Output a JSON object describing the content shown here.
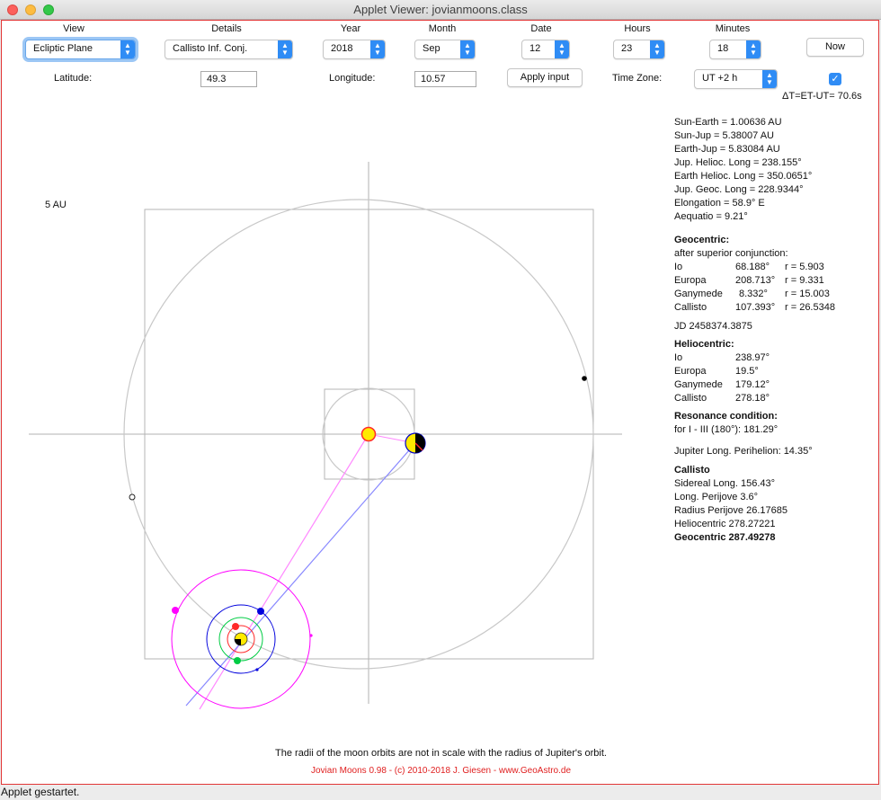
{
  "window": {
    "title": "Applet Viewer: jovianmoons.class"
  },
  "controls": {
    "view": {
      "label": "View",
      "value": "Ecliptic Plane"
    },
    "details": {
      "label": "Details",
      "value": "Callisto Inf. Conj."
    },
    "year": {
      "label": "Year",
      "value": "2018"
    },
    "month": {
      "label": "Month",
      "value": "Sep"
    },
    "date": {
      "label": "Date",
      "value": "12"
    },
    "hours": {
      "label": "Hours",
      "value": "23"
    },
    "minutes": {
      "label": "Minutes",
      "value": "18"
    },
    "now_button": "Now",
    "latitude": {
      "label": "Latitude:",
      "value": "49.3"
    },
    "longitude": {
      "label": "Longitude:",
      "value": "10.57"
    },
    "apply_button": "Apply input",
    "timezone": {
      "label": "Time Zone:",
      "value": "UT +2 h"
    },
    "checkbox_checked": true,
    "delta_t": "ΔT=ET-UT= 70.6s"
  },
  "info": {
    "lines": [
      "Sun-Earth = 1.00636 AU",
      "Sun-Jup   = 5.38007 AU",
      "Earth-Jup  = 5.83084 AU",
      "Jup. Helioc. Long   = 238.155°",
      "Earth Helioc. Long = 350.0651°",
      "Jup. Geoc. Long     = 228.9344°",
      "Elongation = 58.9°  E",
      "Aequatio    = 9.21°"
    ],
    "geocentric": {
      "title": "Geocentric:",
      "subtitle": "after superior conjunction:",
      "rows": [
        {
          "name": "Io",
          "deg": "68.188°",
          "r": "r = 5.903"
        },
        {
          "name": "Europa",
          "deg": "208.713°",
          "r": "r = 9.331"
        },
        {
          "name": "Ganymede",
          "deg": "8.332°",
          "r": "r = 15.003"
        },
        {
          "name": "Callisto",
          "deg": "107.393°",
          "r": "r = 26.5348"
        }
      ]
    },
    "jd": "JD  2458374.3875",
    "heliocentric": {
      "title": "Heliocentric:",
      "rows": [
        {
          "name": "Io",
          "deg": "238.97°"
        },
        {
          "name": "Europa",
          "deg": "19.5°"
        },
        {
          "name": "Ganymede",
          "deg": "179.12°"
        },
        {
          "name": "Callisto",
          "deg": "278.18°"
        }
      ]
    },
    "resonance": {
      "title": "Resonance condition:",
      "text": "for I - III (180°): 181.29°"
    },
    "perihelion": "Jupiter Long. Perihelion: 14.35°",
    "callisto": {
      "title": "Callisto",
      "sidereal": "Sidereal Long. 156.43°",
      "perijove": "Long. Perijove 3.6°",
      "radius": "Radius Perijove 26.17685",
      "heliocentric": "Heliocentric 278.27221",
      "geocentric": "Geocentric 287.49278"
    }
  },
  "diagram": {
    "scale_label": "5 AU",
    "colors": {
      "axes": "#b0b0b0",
      "sun_fill": "#ffea00",
      "sun_stroke": "#ff2a2a",
      "io": "#ff2a2a",
      "europa": "#0000dd",
      "ganymede": "#00cc44",
      "callisto": "#ff00ff",
      "earth_line": "#8080ff",
      "sun_line": "#ff80ff"
    }
  },
  "footer": {
    "note": "The radii of the moon orbits are not in scale with the radius of Jupiter's orbit.",
    "credit": "Jovian Moons 0.98  -   (c) 2010-2018  J. Giesen  -  www.GeoAstro.de"
  },
  "status": "Applet gestartet."
}
